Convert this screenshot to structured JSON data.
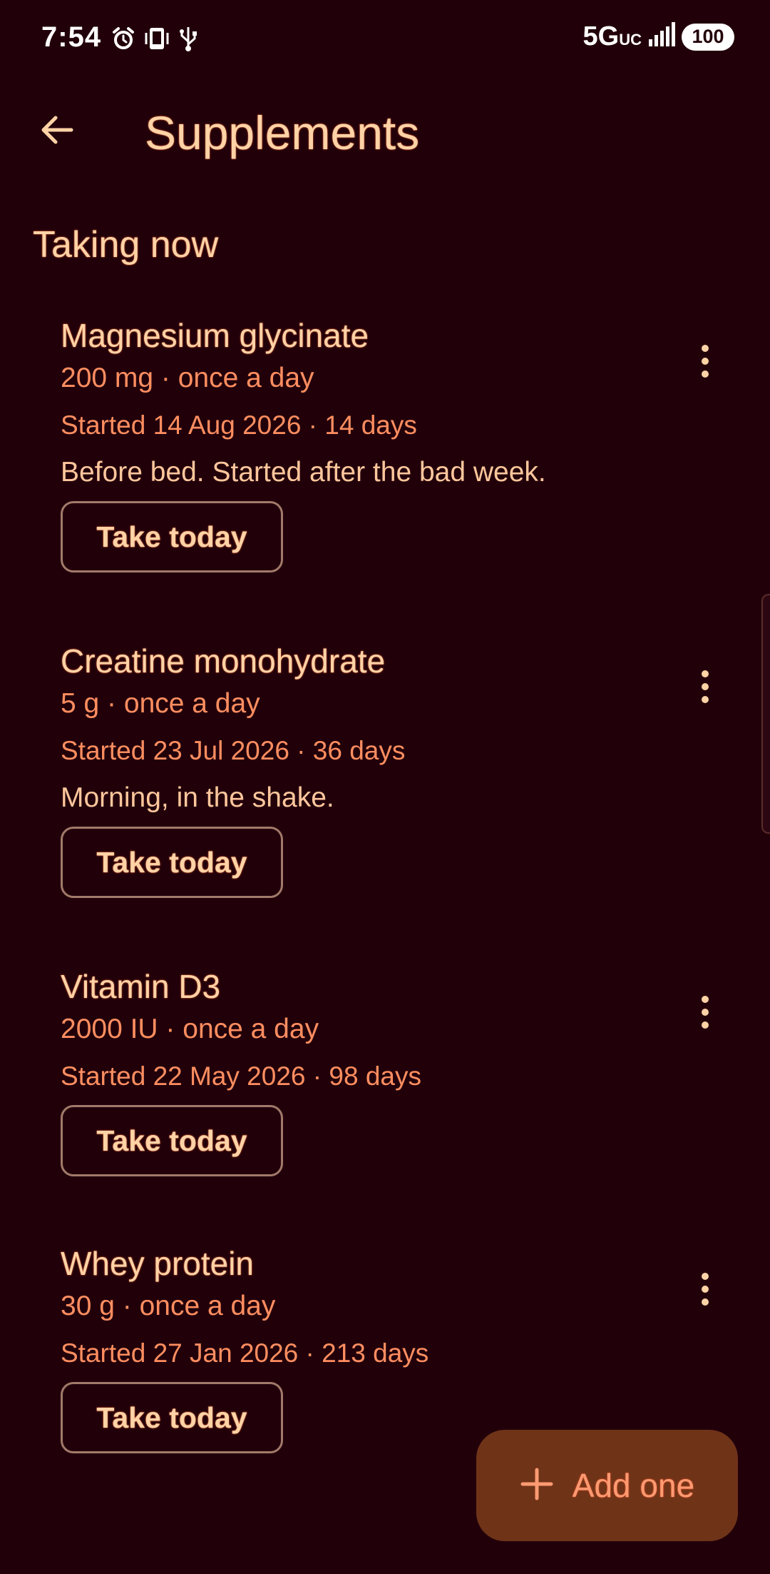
{
  "status_bar": {
    "time": "7:54",
    "network": "5G",
    "network_sub": "UC",
    "battery": "100",
    "icons": [
      "alarm-icon",
      "vibrate-icon",
      "usb-icon",
      "signal-icon"
    ]
  },
  "app_bar": {
    "title": "Supplements",
    "back_icon": "arrow-left-icon"
  },
  "section": {
    "title": "Taking now"
  },
  "supplements": [
    {
      "name": "Magnesium glycinate",
      "dose": "200 mg · once a day",
      "started": "Started 14 Aug 2026 · 14 days",
      "note": "Before bed. Started after the bad week.",
      "action": "Take today"
    },
    {
      "name": "Creatine monohydrate",
      "dose": "5 g · once a day",
      "started": "Started 23 Jul 2026 · 36 days",
      "note": "Morning, in the shake.",
      "action": "Take today"
    },
    {
      "name": "Vitamin D3",
      "dose": "2000 IU · once a day",
      "started": "Started 22 May 2026 · 98 days",
      "action": "Take today"
    },
    {
      "name": "Whey protein",
      "dose": "30 g · once a day",
      "started": "Started 27 Jan 2026 · 213 days",
      "action": "Take today"
    }
  ],
  "fab": {
    "label": "Add one",
    "icon": "plus-icon"
  },
  "colors": {
    "background": "#22000a",
    "title_text": "#ffd3a6",
    "accent_text": "#ff8e60",
    "fab_background": "#6f3318"
  }
}
